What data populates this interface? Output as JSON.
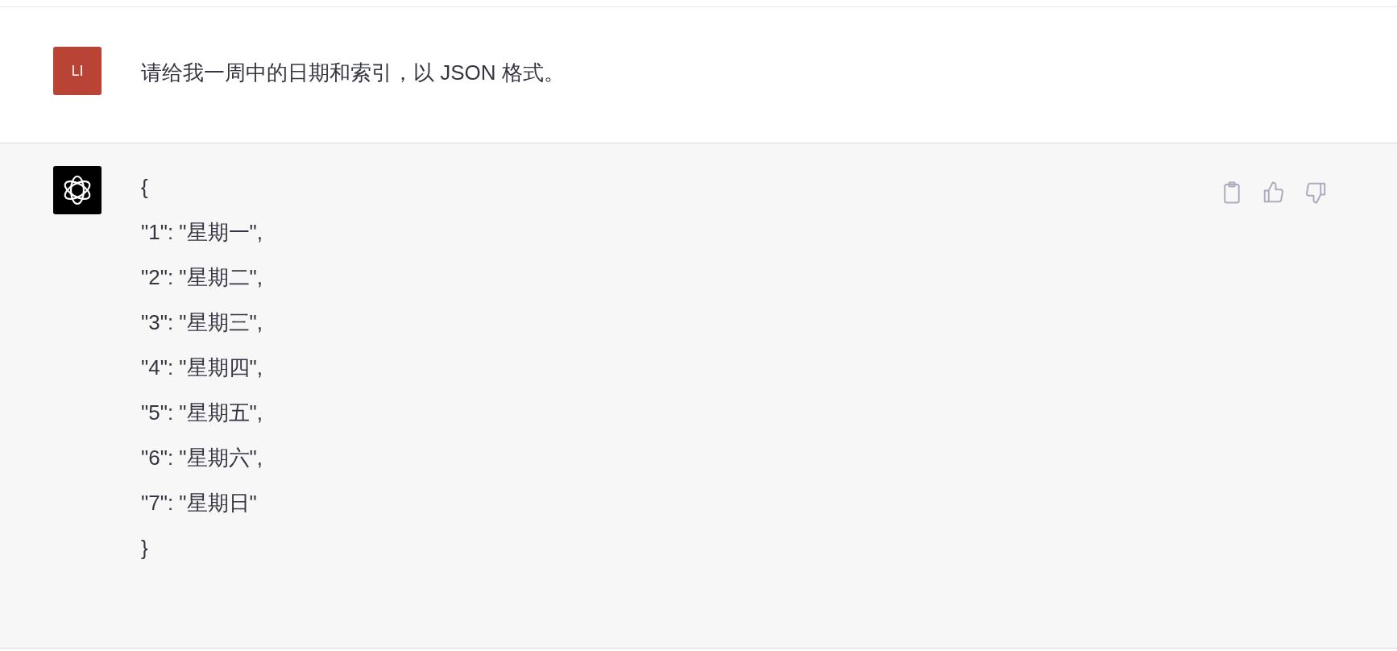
{
  "user_message": {
    "avatar": "LI",
    "text": "请给我一周中的日期和索引，以 JSON 格式。"
  },
  "assistant_message": {
    "lines": [
      "{",
      "\"1\": \"星期一\",",
      "\"2\": \"星期二\",",
      "\"3\": \"星期三\",",
      "\"4\": \"星期四\",",
      "\"5\": \"星期五\",",
      "\"6\": \"星期六\",",
      "\"7\": \"星期日\"",
      "}"
    ]
  }
}
